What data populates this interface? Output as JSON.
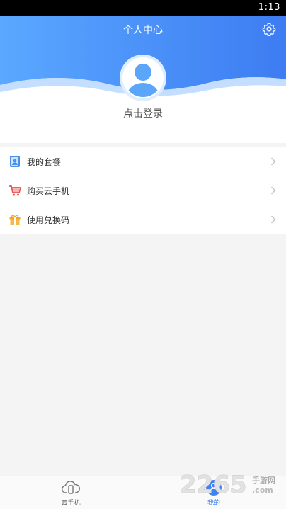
{
  "status_bar": {
    "time": "1:13"
  },
  "header": {
    "title": "个人中心",
    "login_label": "点击登录"
  },
  "menu": {
    "items": [
      {
        "label": "我的套餐",
        "icon": "package-icon"
      },
      {
        "label": "购买云手机",
        "icon": "cart-icon"
      },
      {
        "label": "使用兑换码",
        "icon": "gift-icon"
      }
    ]
  },
  "bottom_nav": {
    "items": [
      {
        "label": "云手机",
        "icon": "cloud-phone-icon",
        "active": false
      },
      {
        "label": "我的",
        "icon": "user-icon",
        "active": true
      }
    ]
  },
  "watermark": {
    "text": "2265",
    "suffix": "手游网",
    "domain": ".com"
  },
  "colors": {
    "accent": "#3e82f5",
    "header_gradient_start": "#5aa8ff",
    "header_gradient_end": "#3d7cf2"
  }
}
